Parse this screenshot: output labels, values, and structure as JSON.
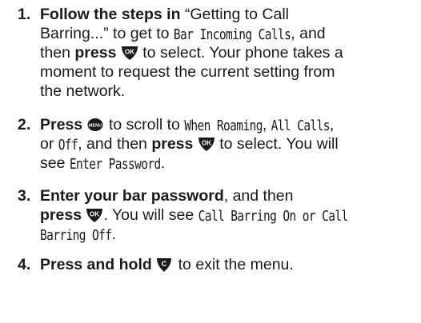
{
  "steps": [
    {
      "number": "1.",
      "lines": [
        {
          "bold": "Follow the steps in",
          "text": " “Getting to Call"
        },
        {
          "text": "Barring...” to get to ",
          "lcd": "Bar Incoming Calls",
          "tail": ", and"
        },
        {
          "text_pre": "then ",
          "bold": "press",
          "key": "ok-key-icon",
          "text": " to select. Your phone takes a"
        },
        {
          "text": "moment to request the current setting from"
        },
        {
          "text": "the network."
        }
      ]
    },
    {
      "number": "2.",
      "lines": [
        {
          "bold": "Press",
          "key": "menu-key-icon",
          "text": " to scroll to ",
          "lcd": "When Roaming",
          "text2": ", ",
          "lcd2": "All Calls",
          "tail": ","
        },
        {
          "text": "or ",
          "lcd": "Off",
          "text2": ", and then ",
          "bold": "press",
          "key": "ok-key-icon",
          "tail": " to select. You will"
        },
        {
          "text": "see ",
          "lcd": "Enter Password",
          "tail": "."
        }
      ]
    },
    {
      "number": "3.",
      "lines": [
        {
          "bold": "Enter your bar password",
          "text": ", and then"
        },
        {
          "bold": "press",
          "key": "ok-key-icon",
          "text": ". You will see ",
          "lcd": "Call Barring On or Call"
        },
        {
          "lcd": "Barring Off",
          "tail": "."
        }
      ]
    },
    {
      "number": "4.",
      "lines": [
        {
          "bold": "Press and hold",
          "key": "clear-key-icon",
          "text": " to exit the menu."
        }
      ]
    }
  ],
  "keys": {
    "ok": "OK",
    "menu": "MENU",
    "clear": "C"
  },
  "colors": {
    "text": "#1a1a1a",
    "key_fill": "#1a1a1a",
    "key_text": "#ffffff"
  }
}
